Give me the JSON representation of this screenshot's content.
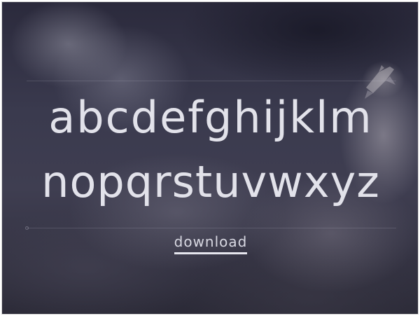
{
  "specimen": {
    "line1": "abcdefghijklm",
    "line2": "nopqrstuvwxyz",
    "text_color": "#e2e2ea"
  },
  "download": {
    "label": "download"
  },
  "background": {
    "description_colors": [
      "#2b2a3c",
      "#3f3e51"
    ]
  }
}
